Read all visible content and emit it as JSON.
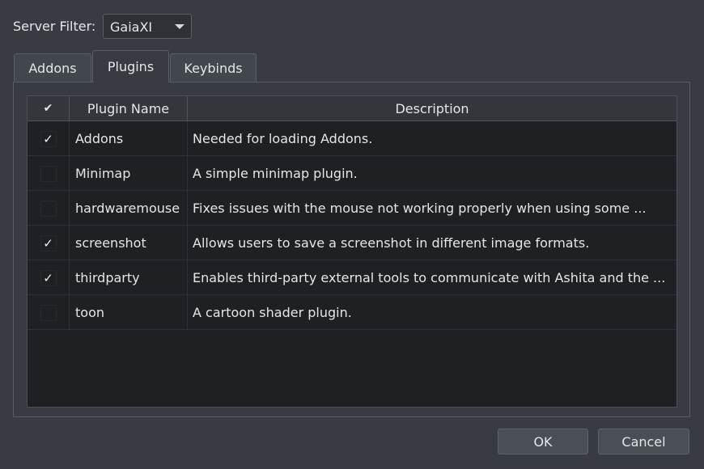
{
  "filter": {
    "label": "Server Filter:",
    "selected": "GaiaXI"
  },
  "tabs": [
    {
      "label": "Addons",
      "active": false
    },
    {
      "label": "Plugins",
      "active": true
    },
    {
      "label": "Keybinds",
      "active": false
    }
  ],
  "table": {
    "headers": {
      "check": "✔",
      "name": "Plugin Name",
      "description": "Description"
    },
    "rows": [
      {
        "enabled": true,
        "check": "✓",
        "name": "Addons",
        "description": "Needed for loading Addons."
      },
      {
        "enabled": false,
        "check": "",
        "name": "Minimap",
        "description": "A simple minimap plugin."
      },
      {
        "enabled": false,
        "check": "",
        "name": "hardwaremouse",
        "description": "Fixes issues with the mouse not working properly when using some ..."
      },
      {
        "enabled": true,
        "check": "✓",
        "name": "screenshot",
        "description": "Allows users to save a screenshot in different image formats."
      },
      {
        "enabled": true,
        "check": "✓",
        "name": "thirdparty",
        "description": "Enables third-party external tools to communicate with Ashita and the ..."
      },
      {
        "enabled": false,
        "check": "",
        "name": "toon",
        "description": "A cartoon shader plugin."
      }
    ]
  },
  "buttons": {
    "ok": "OK",
    "cancel": "Cancel"
  },
  "icons": {
    "dropdown": "chevron-down-icon",
    "check": "checkmark-icon"
  }
}
